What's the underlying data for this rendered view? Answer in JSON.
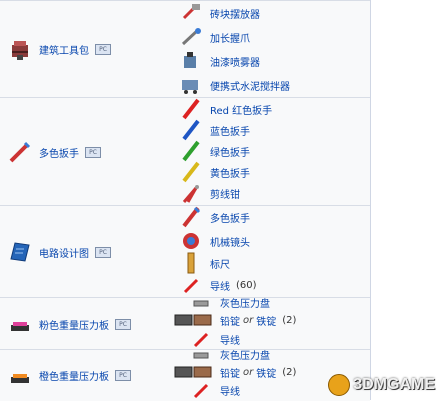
{
  "sections": [
    {
      "name": "建筑工具包",
      "icon": "building-toolkit-icon",
      "items": [
        {
          "label": "砖块摆放器",
          "icon": "brick-layer-icon"
        },
        {
          "label": "加长握爪",
          "icon": "extendo-grip-icon"
        },
        {
          "label": "油漆喷雾器",
          "icon": "paint-sprayer-icon"
        },
        {
          "label": "便携式水泥搅拌器",
          "icon": "cement-mixer-icon"
        }
      ]
    },
    {
      "name": "多色扳手",
      "icon": "multicolor-wrench-icon",
      "items": [
        {
          "label": "Red 红色扳手",
          "icon": "red-wrench-icon"
        },
        {
          "label": "蓝色扳手",
          "icon": "blue-wrench-icon"
        },
        {
          "label": "绿色扳手",
          "icon": "green-wrench-icon"
        },
        {
          "label": "黄色扳手",
          "icon": "yellow-wrench-icon"
        },
        {
          "label": "剪线钳",
          "icon": "wire-cutter-icon"
        }
      ]
    },
    {
      "name": "电路设计图",
      "icon": "circuit-blueprint-icon",
      "items": [
        {
          "label": "多色扳手",
          "icon": "multicolor-wrench-icon"
        },
        {
          "label": "机械镜头",
          "icon": "mechanical-lens-icon"
        },
        {
          "label": "标尺",
          "icon": "ruler-icon"
        },
        {
          "label": "导线",
          "icon": "wire-icon",
          "count": "(60)"
        }
      ]
    },
    {
      "name": "粉色重量压力板",
      "icon": "pink-pressure-plate-icon",
      "items": [
        {
          "label": "灰色压力盘",
          "icon": "gray-pressure-plate-icon"
        },
        {
          "label": "铅锭",
          "or": "or",
          "label2": "铁锭",
          "count": "(2)",
          "icon": "lead-bar-icon"
        },
        {
          "label": "导线",
          "icon": "wire-icon"
        }
      ]
    },
    {
      "name": "橙色重量压力板",
      "icon": "orange-pressure-plate-icon",
      "items": [
        {
          "label": "灰色压力盘",
          "icon": "gray-pressure-plate-icon"
        },
        {
          "label": "铅锭",
          "or": "or",
          "label2": "铁锭",
          "count": "(2)",
          "icon": "lead-bar-icon"
        },
        {
          "label": "导线",
          "icon": "wire-icon"
        }
      ]
    }
  ],
  "watermark": "3DMGAME"
}
